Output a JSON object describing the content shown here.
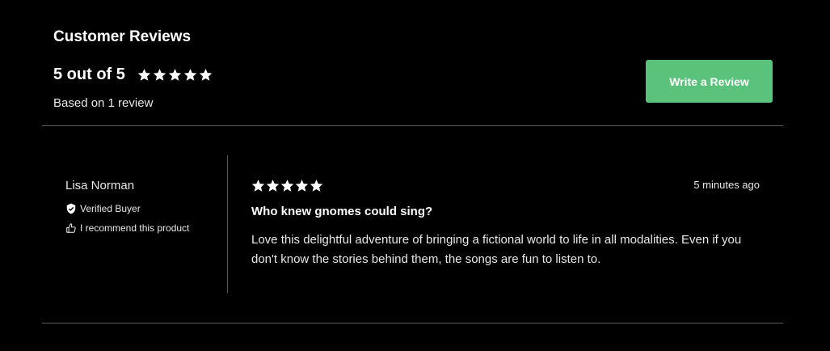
{
  "header": {
    "title": "Customer Reviews",
    "average_rating": "5 out of 5",
    "star_rating": 5,
    "review_count_text": "Based on 1 review",
    "write_review_label": "Write a Review"
  },
  "colors": {
    "background": "#000000",
    "accent": "#5ac27a",
    "divider": "#5a5a5a"
  },
  "reviews": [
    {
      "author": "Lisa Norman",
      "verified_label": "Verified Buyer",
      "recommend_label": "I recommend this product",
      "rating": 5,
      "timestamp": "5 minutes ago",
      "title": "Who knew gnomes could sing?",
      "body": "Love this delightful adventure of bringing a fictional world to life in all modalities. Even if you don't know the stories behind them, the songs are fun to listen to."
    }
  ]
}
